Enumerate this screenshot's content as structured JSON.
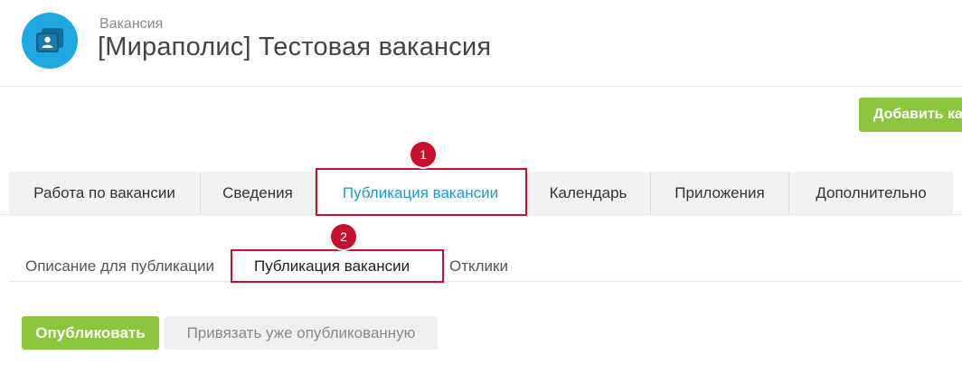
{
  "header": {
    "subtitle": "Вакансия",
    "title": "[Мираполис] Тестовая вакансия",
    "icon": "vacancy-card-icon",
    "icon_color": "#1ea7e1"
  },
  "toolbar": {
    "add_label": "Добавить ка"
  },
  "tabs": [
    {
      "label": "Работа по вакансии"
    },
    {
      "label": "Сведения"
    },
    {
      "label": "Публикация вакансии",
      "active": true
    },
    {
      "label": "Календарь"
    },
    {
      "label": "Приложения"
    },
    {
      "label": "Дополнительно"
    }
  ],
  "subtabs": [
    {
      "label": "Описание для публикации"
    },
    {
      "label": "Публикация вакансии",
      "active": true
    },
    {
      "label": "Отклики"
    }
  ],
  "annotations": [
    {
      "number": "1"
    },
    {
      "number": "2"
    }
  ],
  "actions": {
    "publish_label": "Опубликовать",
    "link_label": "Привязать уже опубликованную"
  },
  "colors": {
    "accent": "#1e9ad6",
    "green": "#8cc63f",
    "annotation_red": "#c8102e"
  }
}
